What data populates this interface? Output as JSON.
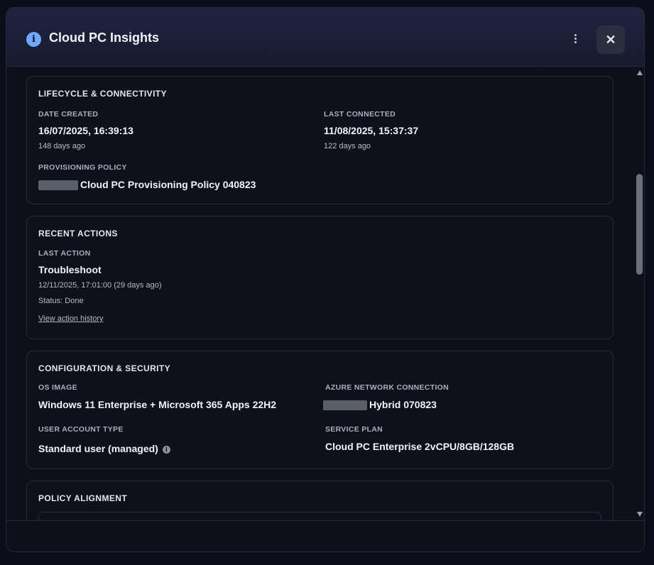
{
  "header": {
    "title": "Cloud PC Insights",
    "info_icon": "info-icon",
    "more_icon": "kebab-menu-icon",
    "close_icon": "close-icon",
    "close_label": "✕"
  },
  "lifecycle": {
    "title": "LIFECYCLE & CONNECTIVITY",
    "date_created_label": "DATE CREATED",
    "date_created_value": "16/07/2025, 16:39:13",
    "date_created_ago": "148 days ago",
    "last_connected_label": "LAST CONNECTED",
    "last_connected_value": "11/08/2025, 15:37:37",
    "last_connected_ago": "122 days ago",
    "provisioning_policy_label": "PROVISIONING POLICY",
    "provisioning_policy_value": "Cloud PC Provisioning Policy 040823"
  },
  "recent_actions": {
    "title": "RECENT ACTIONS",
    "last_action_label": "LAST ACTION",
    "last_action_value": "Troubleshoot",
    "last_action_time": "12/11/2025, 17:01:00 (29 days ago)",
    "status": "Status: Done",
    "history_link": "View action history"
  },
  "configuration": {
    "title": "CONFIGURATION & SECURITY",
    "os_image_label": "OS IMAGE",
    "os_image_value": "Windows 11 Enterprise + Microsoft 365 Apps 22H2",
    "azure_network_label": "AZURE NETWORK CONNECTION",
    "azure_network_value": "Hybrid 070823",
    "user_account_label": "USER ACCOUNT TYPE",
    "user_account_value": "Standard user (managed)",
    "service_plan_label": "SERVICE PLAN",
    "service_plan_value": "Cloud PC Enterprise 2vCPU/8GB/128GB"
  },
  "policy_alignment": {
    "title": "POLICY ALIGNMENT"
  },
  "colors": {
    "accent": "#6fa8ff",
    "background": "#0b0e18",
    "card_border": "#272c3b"
  }
}
